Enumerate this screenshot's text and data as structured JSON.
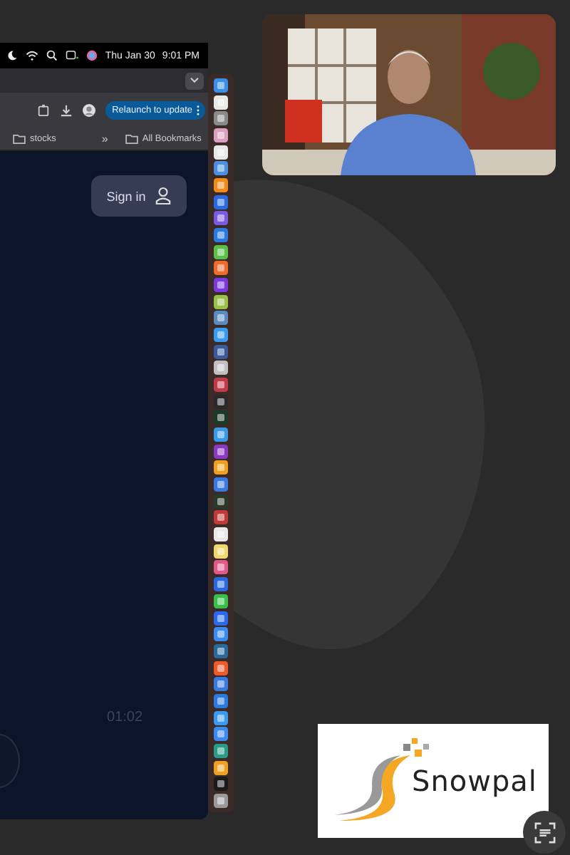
{
  "menu_bar": {
    "date": "Thu Jan 30",
    "time": "9:01 PM"
  },
  "toolbar": {
    "update_button": "Relaunch to update"
  },
  "bookmarks": [
    {
      "label": "stocks",
      "kind": "folder"
    },
    {
      "label": "»",
      "kind": "overflow"
    },
    {
      "label": "All Bookmarks",
      "kind": "folder"
    }
  ],
  "page": {
    "sign_in_button": "Sign in",
    "player_time": "01:02"
  },
  "logo": {
    "text": "Snowpal"
  }
}
